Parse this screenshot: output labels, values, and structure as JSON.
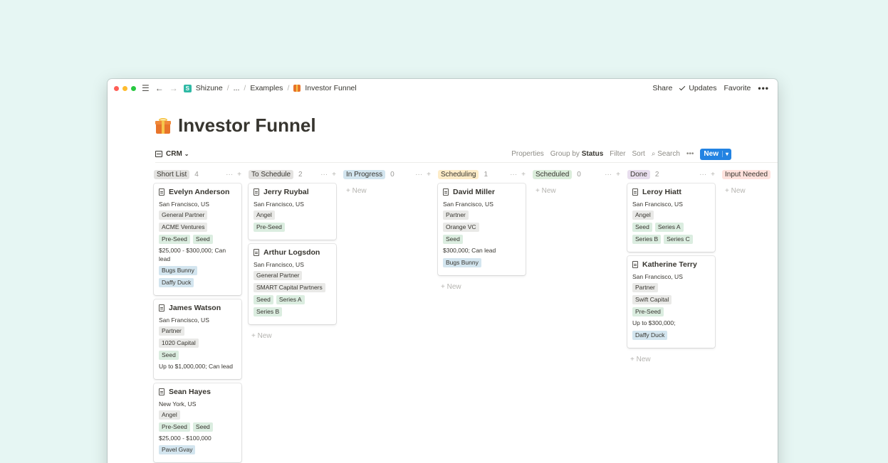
{
  "crumbs": {
    "workspace": "Shizune",
    "ellipsis": "...",
    "examples": "Examples",
    "page": "Investor Funnel"
  },
  "top_right": {
    "share": "Share",
    "updates": "Updates",
    "favorite": "Favorite",
    "more": "•••"
  },
  "page_title": "Investor Funnel",
  "db": {
    "name": "CRM",
    "properties": "Properties",
    "group_by": "Group by",
    "group_by_value": "Status",
    "filter": "Filter",
    "sort": "Sort",
    "search": "Search",
    "more": "•••",
    "new": "New"
  },
  "columns": [
    {
      "status": "Short List",
      "count": "4",
      "color": "#e3e2e0",
      "cards": [
        {
          "name": "Evelyn Anderson",
          "location": "San Francisco, US",
          "tagrows": [
            [
              {
                "t": "General Partner",
                "c": "gray"
              }
            ],
            [
              {
                "t": "ACME Ventures",
                "c": "gray"
              }
            ],
            [
              {
                "t": "Pre-Seed",
                "c": "green"
              },
              {
                "t": "Seed",
                "c": "green"
              }
            ]
          ],
          "amount": "$25,000 - $300,000; Can lead",
          "people": [
            "Bugs Bunny",
            "Daffy Duck"
          ]
        },
        {
          "name": "James Watson",
          "location": "San Francisco, US",
          "tagrows": [
            [
              {
                "t": "Partner",
                "c": "gray"
              }
            ],
            [
              {
                "t": "1020 Capital",
                "c": "gray"
              }
            ],
            [
              {
                "t": "Seed",
                "c": "green"
              }
            ]
          ],
          "amount": "Up to $1,000,000; Can lead",
          "people": []
        },
        {
          "name": "Sean Hayes",
          "location": "New York, US",
          "tagrows": [
            [
              {
                "t": "Angel",
                "c": "gray"
              }
            ],
            [
              {
                "t": "Pre-Seed",
                "c": "green"
              },
              {
                "t": "Seed",
                "c": "green"
              }
            ]
          ],
          "amount": "$25,000 - $100,000",
          "people": [
            "Pavel Gvay"
          ]
        }
      ],
      "partial": true,
      "new": ""
    },
    {
      "status": "To Schedule",
      "count": "2",
      "color": "#e3e2e0",
      "cards": [
        {
          "name": "Jerry Ruybal",
          "location": "San Francisco, US",
          "tagrows": [
            [
              {
                "t": "Angel",
                "c": "gray"
              }
            ],
            [
              {
                "t": "Pre-Seed",
                "c": "green"
              }
            ]
          ],
          "amount": "",
          "people": []
        },
        {
          "name": "Arthur Logsdon",
          "location": "San Francisco, US",
          "tagrows": [
            [
              {
                "t": "General Partner",
                "c": "gray"
              }
            ],
            [
              {
                "t": "SMART Capital Partners",
                "c": "gray"
              }
            ],
            [
              {
                "t": "Seed",
                "c": "green"
              },
              {
                "t": "Series A",
                "c": "green"
              }
            ],
            [
              {
                "t": "Series B",
                "c": "green"
              }
            ]
          ],
          "amount": "",
          "people": []
        }
      ],
      "new": "New"
    },
    {
      "status": "In Progress",
      "count": "0",
      "color": "#d3e5ef",
      "cards": [],
      "new": "New"
    },
    {
      "status": "Scheduling",
      "count": "1",
      "color": "#fdecc8",
      "cards": [
        {
          "name": "David Miller",
          "location": "San Francisco, US",
          "tagrows": [
            [
              {
                "t": "Partner",
                "c": "gray"
              }
            ],
            [
              {
                "t": "Orange VC",
                "c": "gray"
              }
            ],
            [
              {
                "t": "Seed",
                "c": "green"
              }
            ]
          ],
          "amount": "$300,000; Can lead",
          "people": [
            "Bugs Bunny"
          ]
        }
      ],
      "new": "New"
    },
    {
      "status": "Scheduled",
      "count": "0",
      "color": "#dbeddb",
      "cards": [],
      "new": "New"
    },
    {
      "status": "Done",
      "count": "2",
      "color": "#e8deee",
      "cards": [
        {
          "name": "Leroy Hiatt",
          "location": "San Francisco, US",
          "tagrows": [
            [
              {
                "t": "Angel",
                "c": "gray"
              }
            ],
            [
              {
                "t": "Seed",
                "c": "green"
              },
              {
                "t": "Series A",
                "c": "green"
              }
            ],
            [
              {
                "t": "Series B",
                "c": "green"
              },
              {
                "t": "Series C",
                "c": "green"
              }
            ]
          ],
          "amount": "",
          "people": []
        },
        {
          "name": "Katherine Terry",
          "location": "San Francisco, US",
          "tagrows": [
            [
              {
                "t": "Partner",
                "c": "gray"
              }
            ],
            [
              {
                "t": "Swift Capital",
                "c": "gray"
              }
            ],
            [
              {
                "t": "Pre-Seed",
                "c": "green"
              }
            ]
          ],
          "amount": "Up to $300,000;",
          "people": [
            "Daffy Duck"
          ]
        }
      ],
      "new": "New"
    },
    {
      "status": "Input Needed",
      "count": "",
      "color": "#ffe2dd",
      "cards": [],
      "new": "New",
      "noactions": true
    }
  ]
}
